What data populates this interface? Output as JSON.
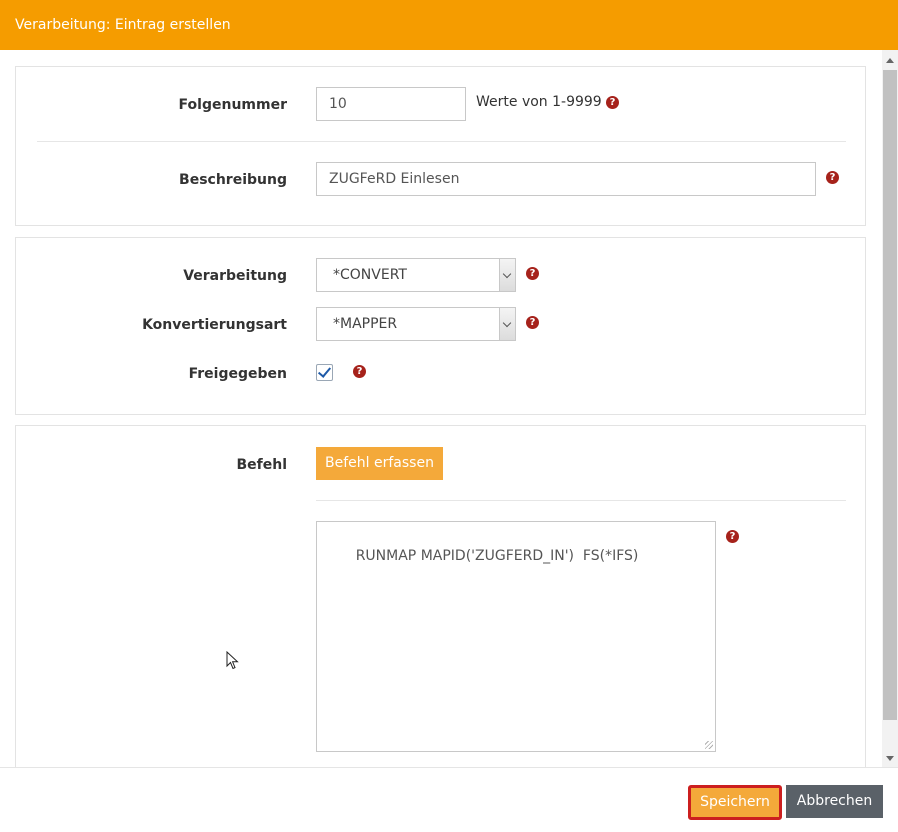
{
  "dialog": {
    "title": "Verarbeitung: Eintrag erstellen"
  },
  "fields": {
    "sequence": {
      "label": "Folgenummer",
      "value": "10",
      "hint": "Werte von 1-9999"
    },
    "description": {
      "label": "Beschreibung",
      "value": "ZUGFeRD Einlesen"
    },
    "processing": {
      "label": "Verarbeitung",
      "selected": "*CONVERT"
    },
    "conversion_type": {
      "label": "Konvertierungsart",
      "selected": "*MAPPER"
    },
    "released": {
      "label": "Freigegeben",
      "checked": true
    },
    "command": {
      "label": "Befehl",
      "capture_button": "Befehl erfassen",
      "value": "RUNMAP MAPID('ZUGFERD_IN')  FS(*IFS)"
    }
  },
  "help_icon_glyph": "?",
  "footer": {
    "save_label": "Speichern",
    "cancel_label": "Abbrechen"
  },
  "colors": {
    "accent": "#f59c00",
    "button": "#f4a93a",
    "help": "#a6221b",
    "cancel": "#5a6168",
    "save_border": "#cc1f1f"
  }
}
